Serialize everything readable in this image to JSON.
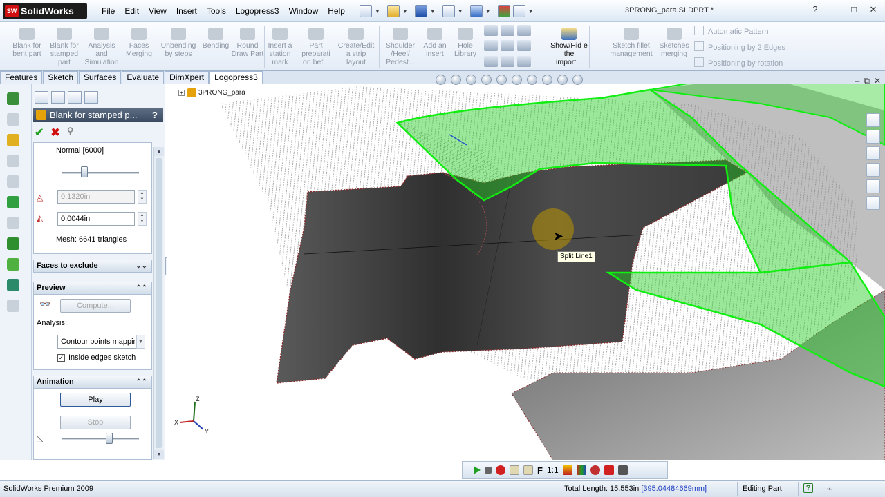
{
  "app": {
    "brand": "SolidWorks",
    "brand_badge": "SW",
    "file_title": "3PRONG_para.SLDPRT *"
  },
  "menu": [
    "File",
    "Edit",
    "View",
    "Insert",
    "Tools",
    "Logopress3",
    "Window",
    "Help"
  ],
  "toolbar": [
    {
      "label": "Blank for bent part"
    },
    {
      "label": "Blank for stamped part"
    },
    {
      "label": "Analysis and Simulation"
    },
    {
      "label": "Faces Merging"
    },
    {
      "label": "Unbending by steps"
    },
    {
      "label": "Bending"
    },
    {
      "label": "Round Draw Part"
    },
    {
      "label": "Insert a station mark"
    },
    {
      "label": "Part preparati on bef..."
    },
    {
      "label": "Create/Edit a strip layout"
    },
    {
      "label": "Shoulder /Heel/ Pedest..."
    },
    {
      "label": "Add an insert"
    },
    {
      "label": "Hole Library"
    },
    {
      "label": "Show/Hid e the import..."
    },
    {
      "label": "Sketch fillet management"
    },
    {
      "label": "Sketches merging"
    }
  ],
  "toolbar_options": [
    "Automatic Pattern",
    "Positioning by 2 Edges",
    "Positioning by rotation"
  ],
  "tabs": [
    "Features",
    "Sketch",
    "Surfaces",
    "Evaluate",
    "DimXpert",
    "Logopress3"
  ],
  "active_tab": "Logopress3",
  "property_manager": {
    "title": "Blank for stamped p...",
    "help": "?",
    "mesh_quality": "Normal [6000]",
    "tolerance_1": "0.1320in",
    "tolerance_2": "0.0044in",
    "mesh_info": "Mesh: 6641 triangles",
    "faces_to_exclude": "Faces to exclude",
    "preview": {
      "heading": "Preview",
      "compute_label": "Compute...",
      "analysis_label": "Analysis:",
      "analysis_value": "Contour points mappin",
      "inside_edges_label": "Inside edges sketch",
      "inside_edges_checked": true
    },
    "animation": {
      "heading": "Animation",
      "play_label": "Play",
      "stop_label": "Stop"
    }
  },
  "feature_tree": {
    "root": "3PRONG_para"
  },
  "viewport": {
    "tooltip": "Split Line1",
    "axes": {
      "x": "X",
      "y": "Y",
      "z": "Z"
    }
  },
  "bottom_toolbar": {
    "scale_label": "1:1",
    "f_label": "F"
  },
  "status": {
    "product": "SolidWorks Premium 2009",
    "total_length_label": "Total Length: 15.553in",
    "total_length_mm": "[395.04484669mm]",
    "mode": "Editing Part",
    "help_badge": "?"
  },
  "colors": {
    "surface_green": "#22cc22",
    "part_gray": "#4a4a4a",
    "titlebar": "#dce8f5"
  }
}
